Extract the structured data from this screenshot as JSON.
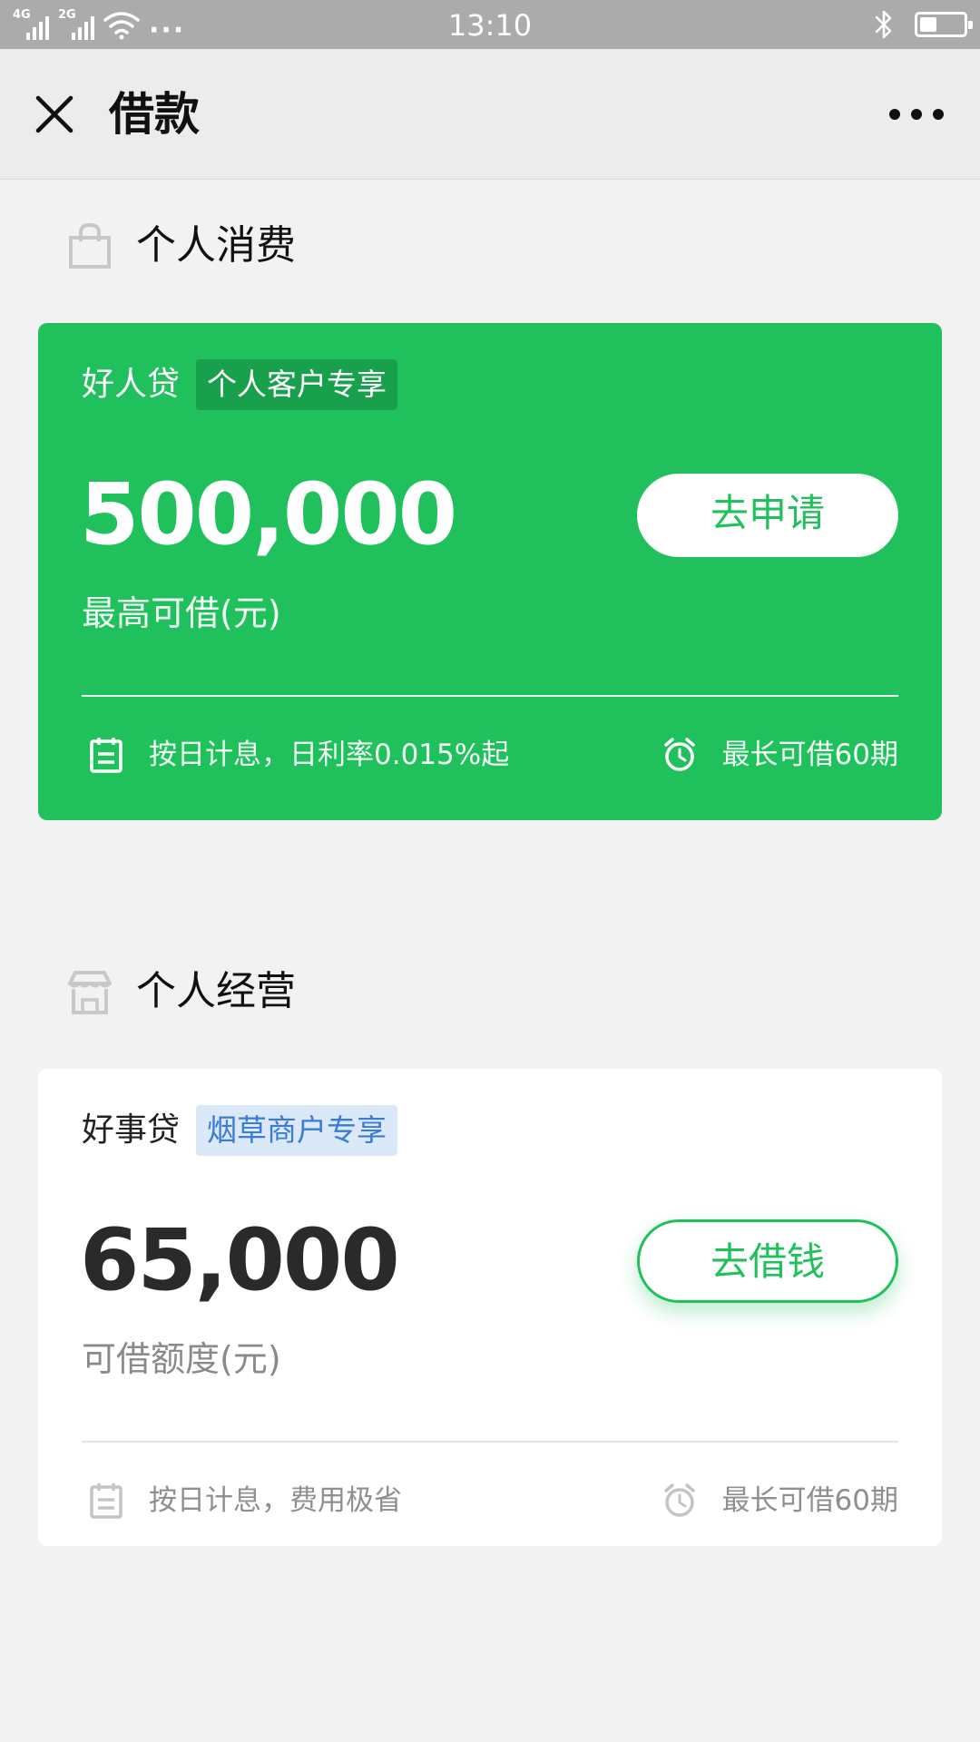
{
  "status_bar": {
    "network_1": "4G",
    "network_2": "2G",
    "time": "13:10",
    "battery_level": 0.4
  },
  "header": {
    "title": "借款",
    "close_icon": "close-icon",
    "more_icon": "more-dots-icon"
  },
  "sections": [
    {
      "title": "个人消费",
      "icon": "shopping-bag-icon",
      "card": {
        "brand": "好人贷",
        "tag": "个人客户专享",
        "amount": "500,000",
        "amount_label": "最高可借(元)",
        "button_label": "去申请",
        "feature_left": "按日计息，日利率0.015%起",
        "feature_right": "最长可借60期",
        "feature_left_icon": "calendar-icon",
        "feature_right_icon": "alarm-clock-icon"
      }
    },
    {
      "title": "个人经营",
      "icon": "store-icon",
      "card": {
        "brand": "好事贷",
        "tag": "烟草商户专享",
        "amount": "65,000",
        "amount_label": "可借额度(元)",
        "button_label": "去借钱",
        "feature_left": "按日计息，费用极省",
        "feature_right": "最长可借60期",
        "feature_left_icon": "calendar-icon",
        "feature_right_icon": "alarm-clock-icon"
      }
    }
  ],
  "colors": {
    "accent_green": "#20c05c",
    "tag_blue_bg": "#dbe8f7",
    "tag_blue_text": "#3a7bd5",
    "background": "#f2f2f2"
  }
}
